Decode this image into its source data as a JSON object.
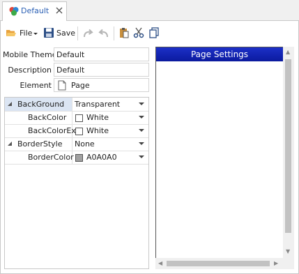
{
  "tab": {
    "label": "Default",
    "icon": "colors-icon",
    "close_icon": "close-icon"
  },
  "toolbar": {
    "file_label": "File",
    "save_label": "Save",
    "icons": [
      "open-folder-icon",
      "save-icon",
      "redo-icon",
      "undo-icon",
      "paste-icon",
      "cut-icon",
      "copy-icon"
    ]
  },
  "form": {
    "mobile_theme_label": "Mobile Theme",
    "mobile_theme_value": "Default",
    "description_label": "Description",
    "description_value": "Default",
    "element_label": "Element",
    "element_value": "Page"
  },
  "grid": {
    "rows": [
      {
        "name": "BackGround",
        "value": "Transparent",
        "category": true
      },
      {
        "name": "BackColor",
        "value": "White",
        "swatch": "#ffffff"
      },
      {
        "name": "BackColorEx",
        "value": "White",
        "swatch": "#ffffff"
      },
      {
        "name": "BorderStyle",
        "value": "None",
        "category": true
      },
      {
        "name": "BorderColor",
        "value": "A0A0A0",
        "swatch": "#a0a0a0"
      }
    ]
  },
  "preview": {
    "header": "Page Settings"
  },
  "colors": {
    "accent": "#2a5fb4",
    "header": "#0b1a9e",
    "selected_row": "#dbe5f3"
  }
}
